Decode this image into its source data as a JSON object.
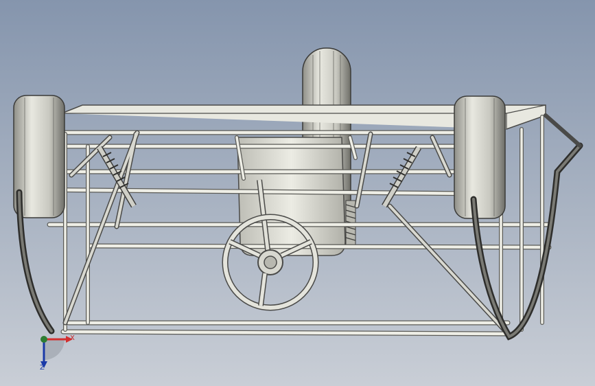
{
  "viewport": {
    "background_top": "#8595ad",
    "background_bottom": "#c9ced6"
  },
  "model": {
    "frame_color": "#e4e4dc",
    "frame_outline": "#4a4a48",
    "tire_color": "#d4d4cc",
    "bumper_color": "#3e3e3c"
  },
  "triad": {
    "x_label": "X",
    "z_label": "Z",
    "x_color": "#d32f2f",
    "y_color": "#2e7d32",
    "z_color": "#1a3aa8"
  }
}
